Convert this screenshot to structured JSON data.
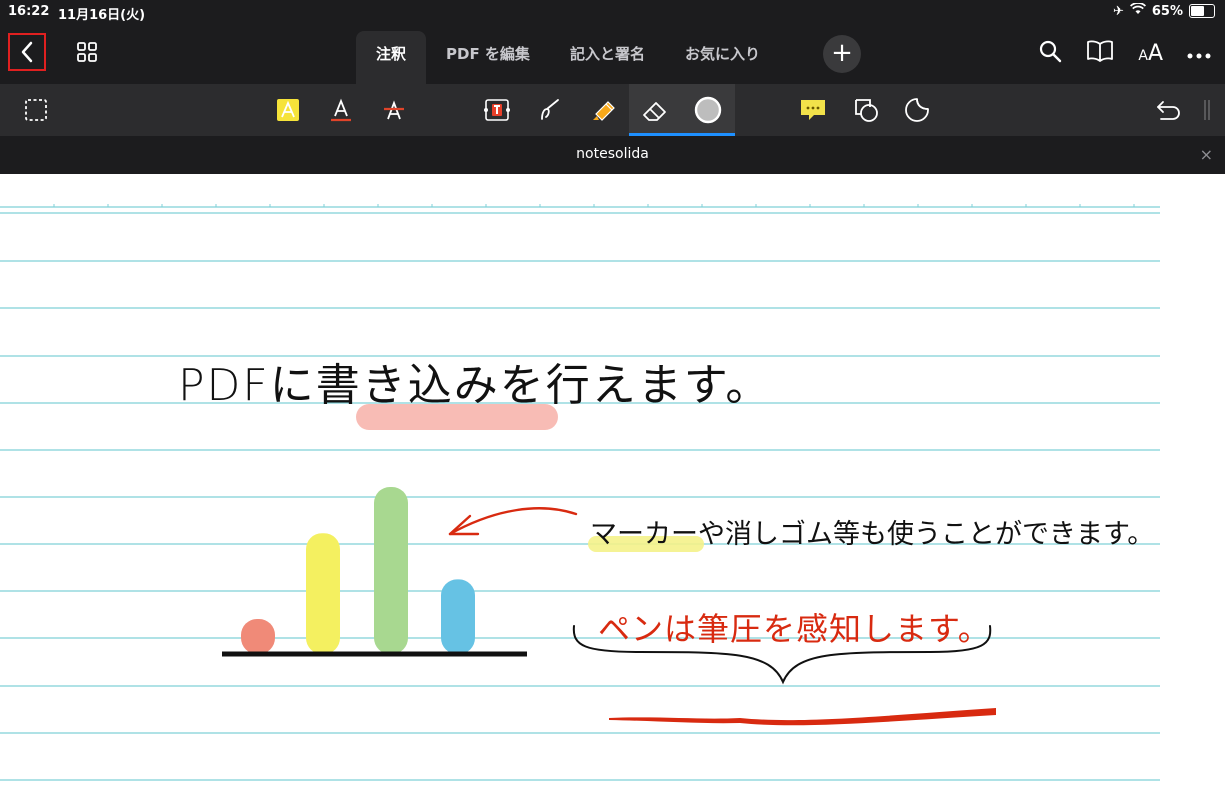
{
  "status": {
    "time": "16:22",
    "date": "11月16日(火)",
    "battery": "65%",
    "battery_level": 0.65
  },
  "nav": {
    "tabs": [
      {
        "label": "注釈",
        "active": true
      },
      {
        "label": "PDF を編集",
        "active": false
      },
      {
        "label": "記入と署名",
        "active": false
      },
      {
        "label": "お気に入り",
        "active": false
      }
    ],
    "plus": "+",
    "text_size": {
      "small": "A",
      "large": "A"
    }
  },
  "toolbar": {
    "icons": [
      "select-icon",
      "highlight-icon",
      "underline-icon",
      "strikethrough-icon",
      "textbox-icon",
      "pen-icon",
      "marker-icon",
      "eraser-icon",
      "color-icon",
      "comment-icon",
      "shape-icon",
      "sticker-icon",
      "undo-icon"
    ]
  },
  "document": {
    "filename": "notesolida",
    "close": "×"
  },
  "handwriting": {
    "line1": "PDFに書き込みを行えます。",
    "line2": "マーカーや消しゴム等も使うことができます。",
    "line3": "ペンは筆圧を感知します。"
  },
  "colors": {
    "accent": "#1e90ff",
    "ruled": "#7fd0d8",
    "ink_red": "#d82a10",
    "marker_pink": "#f7b0a8",
    "marker_yellow": "#f4f28a"
  },
  "bars": [
    {
      "color": "#f08a78",
      "value": 1
    },
    {
      "color": "#f4f060",
      "value": 3.6
    },
    {
      "color": "#a8d890",
      "value": 5
    },
    {
      "color": "#66c2e4",
      "value": 2.2
    }
  ]
}
